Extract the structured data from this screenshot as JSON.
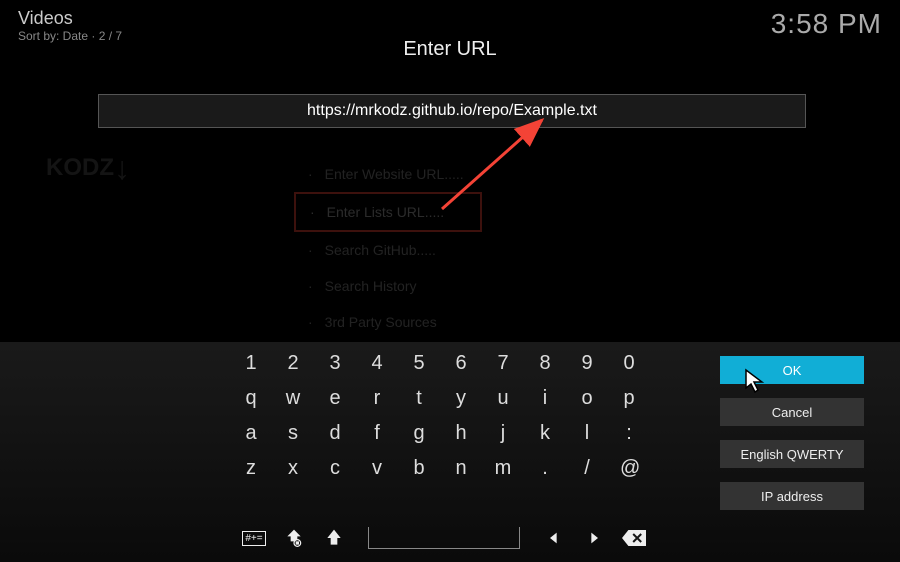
{
  "header": {
    "title": "Videos",
    "sortby": "Sort by: Date  ·  2 / 7",
    "clock": "3:58 PM"
  },
  "dialog": {
    "title": "Enter URL",
    "url_value": "https://mrkodz.github.io/repo/Example.txt"
  },
  "background_list": {
    "items": [
      "Enter Website URL.....",
      "Enter Lists URL.....",
      "Search GitHub.....",
      "Search History",
      "3rd Party Sources"
    ]
  },
  "keyboard": {
    "row1": [
      "1",
      "2",
      "3",
      "4",
      "5",
      "6",
      "7",
      "8",
      "9",
      "0"
    ],
    "row2": [
      "q",
      "w",
      "e",
      "r",
      "t",
      "y",
      "u",
      "i",
      "o",
      "p"
    ],
    "row3": [
      "a",
      "s",
      "d",
      "f",
      "g",
      "h",
      "j",
      "k",
      "l",
      ":"
    ],
    "row4": [
      "z",
      "x",
      "c",
      "v",
      "b",
      "n",
      "m",
      ".",
      "/",
      "@"
    ]
  },
  "actions": {
    "ok": "OK",
    "cancel": "Cancel",
    "layout": "English QWERTY",
    "ip": "IP address"
  },
  "bottom_icons": {
    "symbols": "#+=",
    "lock": "lock",
    "shift": "shift",
    "space": "space",
    "left": "left",
    "right": "right",
    "backspace": "backspace"
  }
}
